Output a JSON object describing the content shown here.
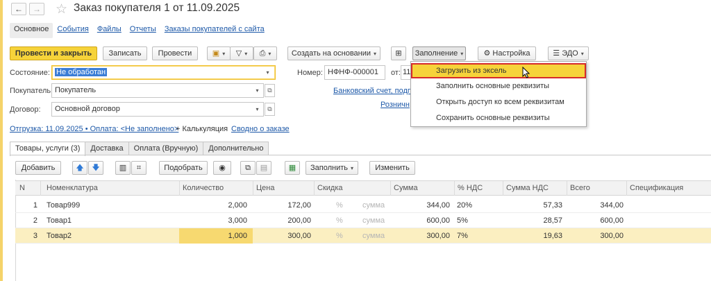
{
  "window": {
    "title": "Заказ покупателя 1 от 11.09.2025"
  },
  "nav_tabs": [
    {
      "label": "Основное"
    },
    {
      "label": "События"
    },
    {
      "label": "Файлы"
    },
    {
      "label": "Отчеты"
    },
    {
      "label": "Заказы покупателей с сайта"
    }
  ],
  "toolbar": {
    "post_close": "Провести и закрыть",
    "save": "Записать",
    "post": "Провести",
    "create_based": "Создать на основании",
    "fill": "Заполнение",
    "settings": "Настройка",
    "edo": "ЭДО"
  },
  "fill_menu": [
    {
      "label": "Загрузить из эксель"
    },
    {
      "label": "Заполнить основные реквизиты"
    },
    {
      "label": "Открыть доступ ко всем реквизитам"
    },
    {
      "label": "Сохранить основные реквизиты"
    }
  ],
  "form": {
    "state_label": "Состояние:",
    "state_value": "Не обработан",
    "buyer_label": "Покупатель:",
    "buyer_value": "Покупатель",
    "contract_label": "Договор:",
    "contract_value": "Основной договор",
    "number_label": "Номер:",
    "number_value": "НФНФ-000001",
    "date_label": "от:",
    "date_value": "11",
    "bank_link": "Банковский счет, подпи",
    "retail_link": "Розничн"
  },
  "links": {
    "shipment": "Отгрузка: 11.09.2025 • Оплата: <Не заполнено>",
    "calc": "+ Калькуляция",
    "summary": "Сводно о заказе"
  },
  "section_tabs": [
    {
      "label": "Товары, услуги (3)"
    },
    {
      "label": "Доставка"
    },
    {
      "label": "Оплата (Вручную)"
    },
    {
      "label": "Дополнительно"
    }
  ],
  "table_toolbar": {
    "add": "Добавить",
    "pick": "Подобрать",
    "fill": "Заполнить",
    "change": "Изменить"
  },
  "table": {
    "headers": [
      "N",
      "Номенклатура",
      "Количество",
      "Цена",
      "Скидка",
      "Сумма",
      "% НДС",
      "Сумма НДС",
      "Всего",
      "Спецификация"
    ],
    "rows": [
      {
        "n": "1",
        "name": "Товар999",
        "qty": "2,000",
        "price": "172,00",
        "pct": "%",
        "disc": "сумма",
        "sum": "344,00",
        "vat": "20%",
        "vat_sum": "57,33",
        "total": "344,00"
      },
      {
        "n": "2",
        "name": "Товар1",
        "qty": "3,000",
        "price": "200,00",
        "pct": "%",
        "disc": "сумма",
        "sum": "600,00",
        "vat": "5%",
        "vat_sum": "28,57",
        "total": "600,00"
      },
      {
        "n": "3",
        "name": "Товар2",
        "qty": "1,000",
        "price": "300,00",
        "pct": "%",
        "disc": "сумма",
        "sum": "300,00",
        "vat": "7%",
        "vat_sum": "19,63",
        "total": "300,00"
      }
    ]
  },
  "colors": {
    "accent": "#f6d33a",
    "link": "#1c58a8",
    "highlight_border": "#d62a2a"
  }
}
